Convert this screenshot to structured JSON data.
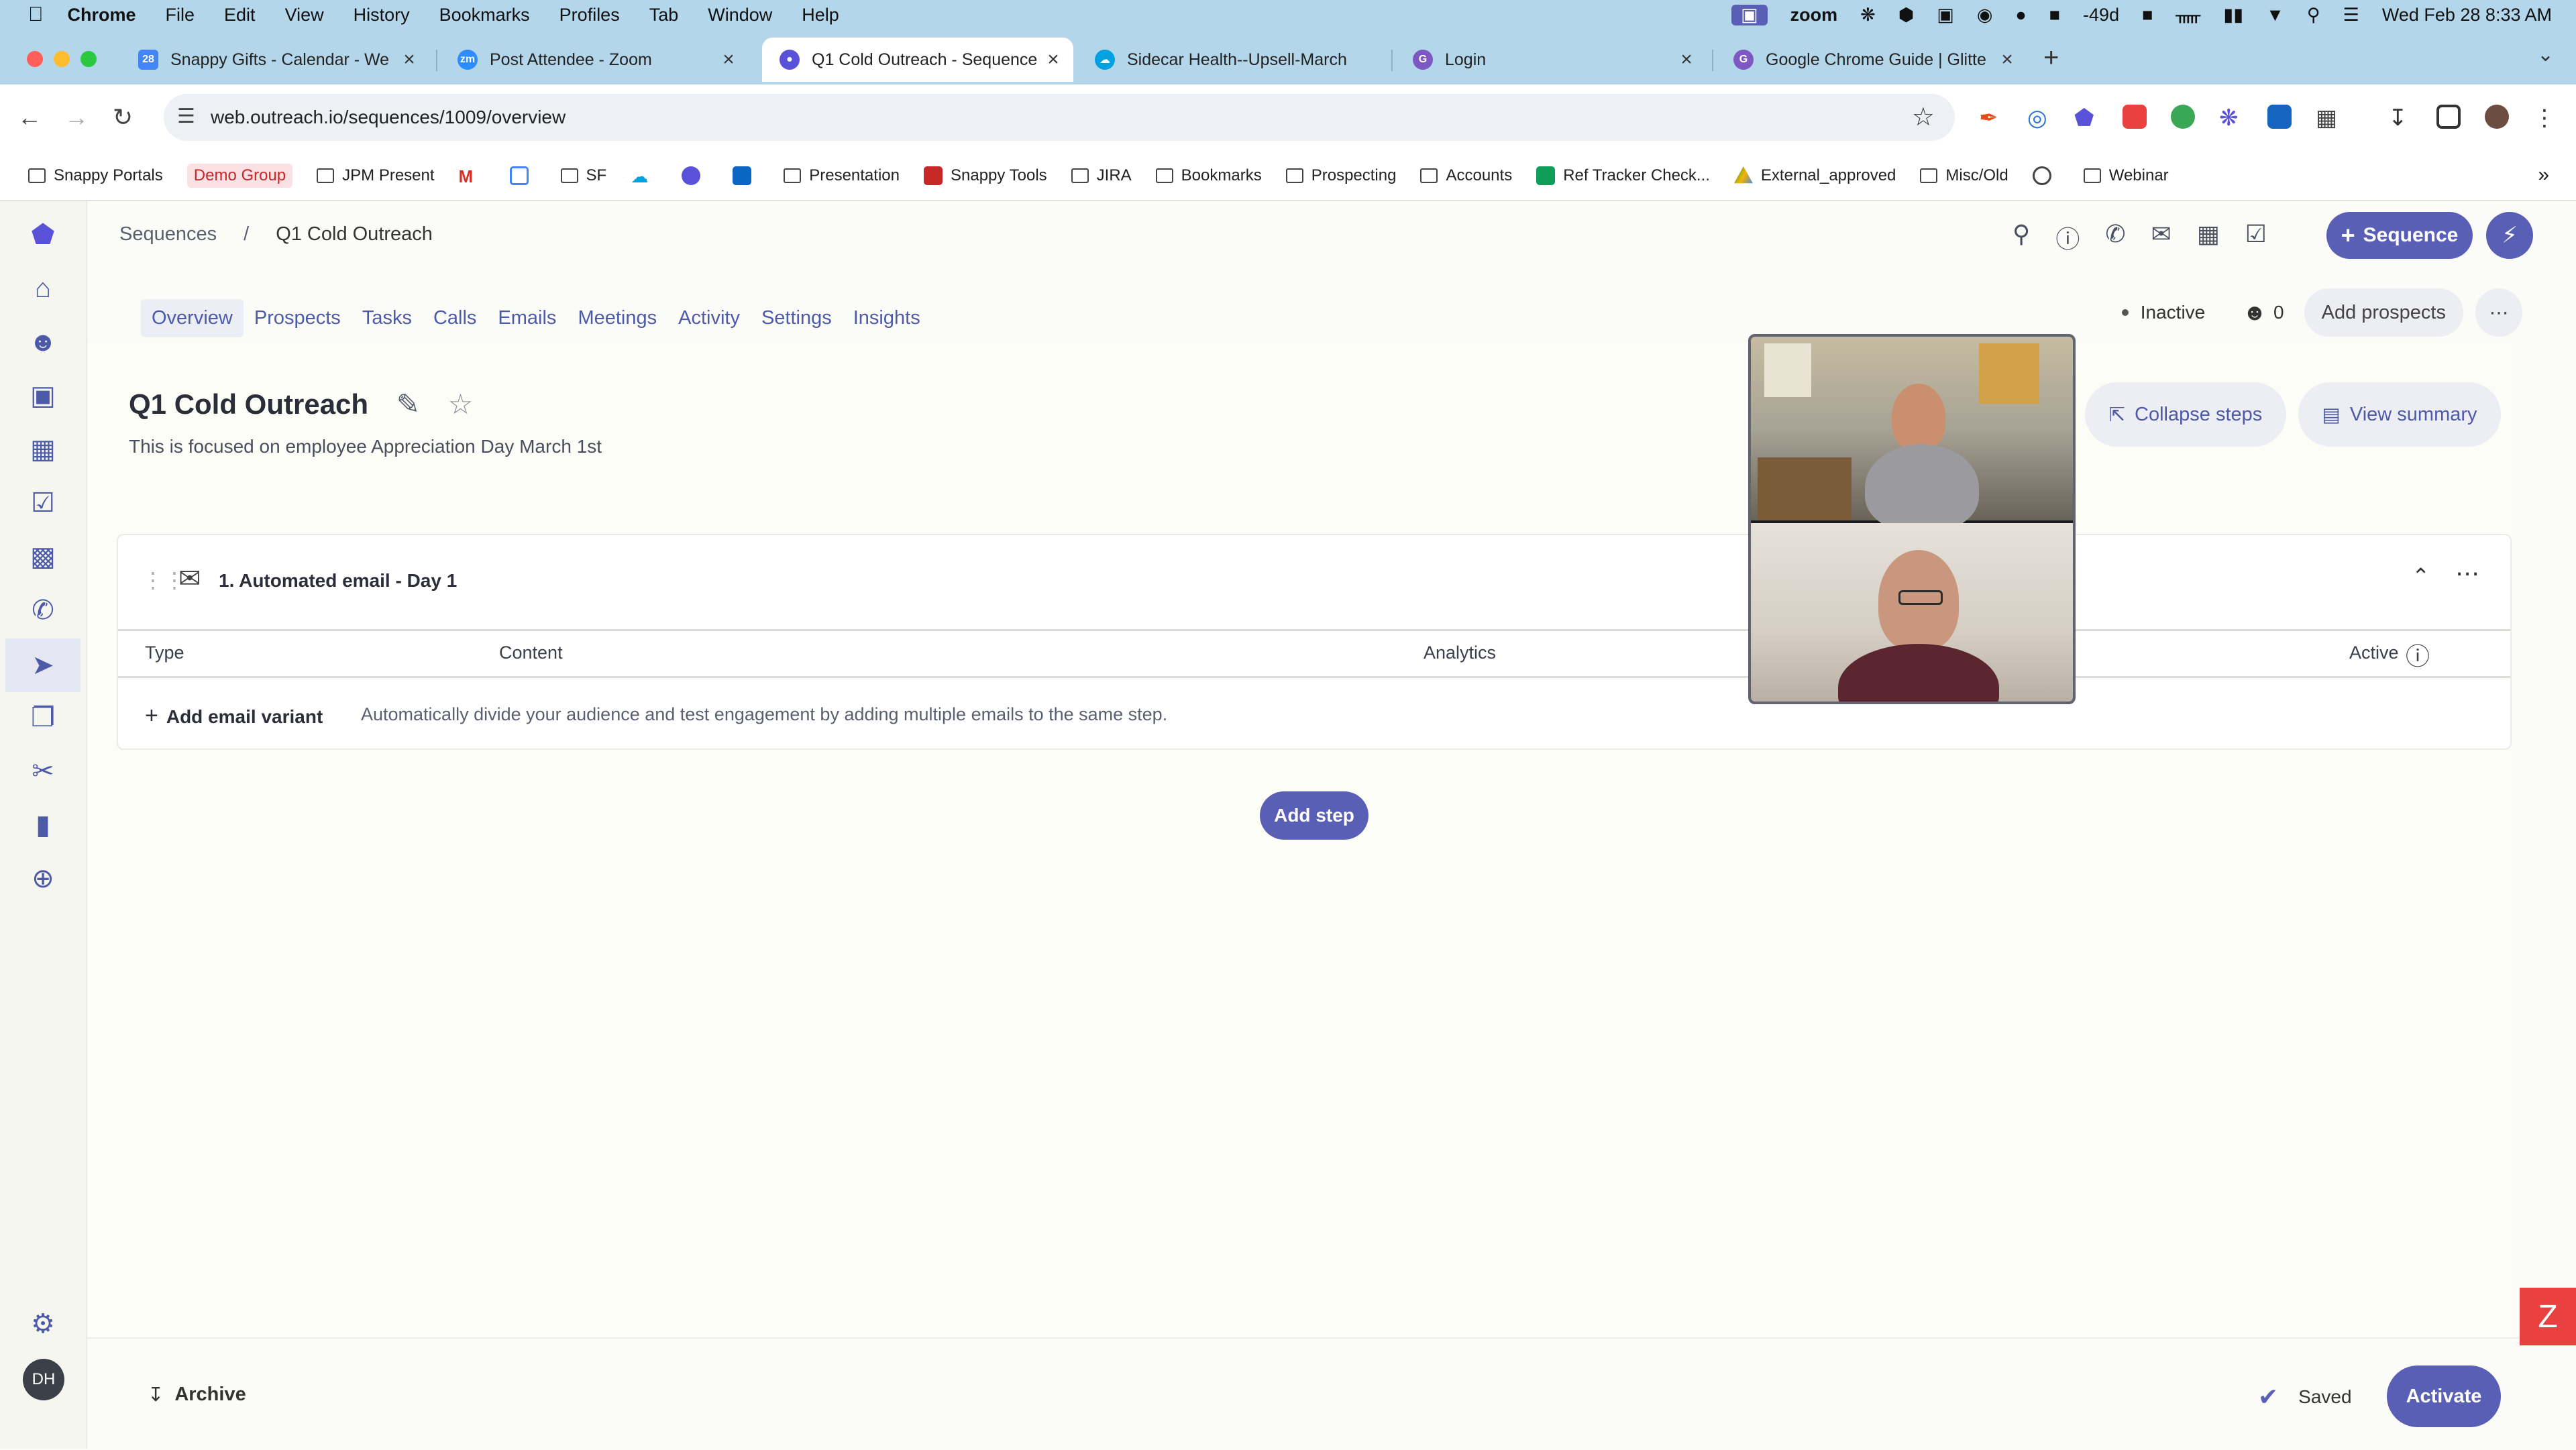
{
  "menubar": {
    "app": "Chrome",
    "items": [
      "File",
      "Edit",
      "View",
      "History",
      "Bookmarks",
      "Profiles",
      "Tab",
      "Window",
      "Help"
    ],
    "zoom": "zoom",
    "weather": "-49d",
    "datetime": "Wed Feb 28  8:33 AM"
  },
  "tabs": [
    {
      "title": "Snappy Gifts - Calendar - We",
      "color": "#4285f4"
    },
    {
      "title": "Post Attendee - Zoom",
      "color": "#2d8cff"
    },
    {
      "title": "Q1 Cold Outreach - Sequence",
      "color": "#5951d8"
    },
    {
      "title": "Sidecar Health--Upsell-March",
      "color": "#00a1e0"
    },
    {
      "title": "Login",
      "color": "#7e57c2"
    },
    {
      "title": "Google Chrome Guide | Glitte",
      "color": "#7e57c2"
    }
  ],
  "address": {
    "url": "web.outreach.io/sequences/1009/overview"
  },
  "bookmarks": [
    {
      "label": "Snappy Portals",
      "type": "folder"
    },
    {
      "label": "Demo Group",
      "type": "tag"
    },
    {
      "label": "JPM Present",
      "type": "folder"
    },
    {
      "label": "SF",
      "type": "folder"
    },
    {
      "label": "Presentation",
      "type": "folder"
    },
    {
      "label": "Snappy Tools",
      "type": "site"
    },
    {
      "label": "JIRA",
      "type": "folder"
    },
    {
      "label": "Bookmarks",
      "type": "folder"
    },
    {
      "label": "Prospecting",
      "type": "folder"
    },
    {
      "label": "Accounts",
      "type": "folder"
    },
    {
      "label": "Ref Tracker Check...",
      "type": "sheet"
    },
    {
      "label": "External_approved",
      "type": "drive"
    },
    {
      "label": "Misc/Old",
      "type": "folder"
    },
    {
      "label": "Webinar",
      "type": "folder"
    }
  ],
  "breadcrumb": {
    "root": "Sequences",
    "sep": "/",
    "current": "Q1 Cold Outreach"
  },
  "header": {
    "new_sequence": "Sequence"
  },
  "nav_tabs": [
    "Overview",
    "Prospects",
    "Tasks",
    "Calls",
    "Emails",
    "Meetings",
    "Activity",
    "Settings",
    "Insights"
  ],
  "status": {
    "state": "Inactive",
    "prospect_count": "0",
    "add_prospects": "Add prospects"
  },
  "sequence": {
    "title": "Q1 Cold Outreach",
    "description": "This is focused on employee Appreciation Day March 1st",
    "collapse": "Collapse steps",
    "summary": "View summary"
  },
  "step": {
    "title": "1. Automated email - Day 1",
    "columns": {
      "type": "Type",
      "content": "Content",
      "analytics": "Analytics",
      "active": "Active"
    },
    "add_variant": "Add email variant",
    "hint": "Automatically divide your audience and test engagement by adding multiple emails to the same step."
  },
  "add_step": "Add step",
  "footer": {
    "archive": "Archive",
    "saved": "Saved",
    "activate": "Activate"
  },
  "user_initials": "DH",
  "colors": {
    "accent": "#5a5fb6",
    "nav": "#4d5aa8",
    "tabbar": "#b4d6ea"
  }
}
